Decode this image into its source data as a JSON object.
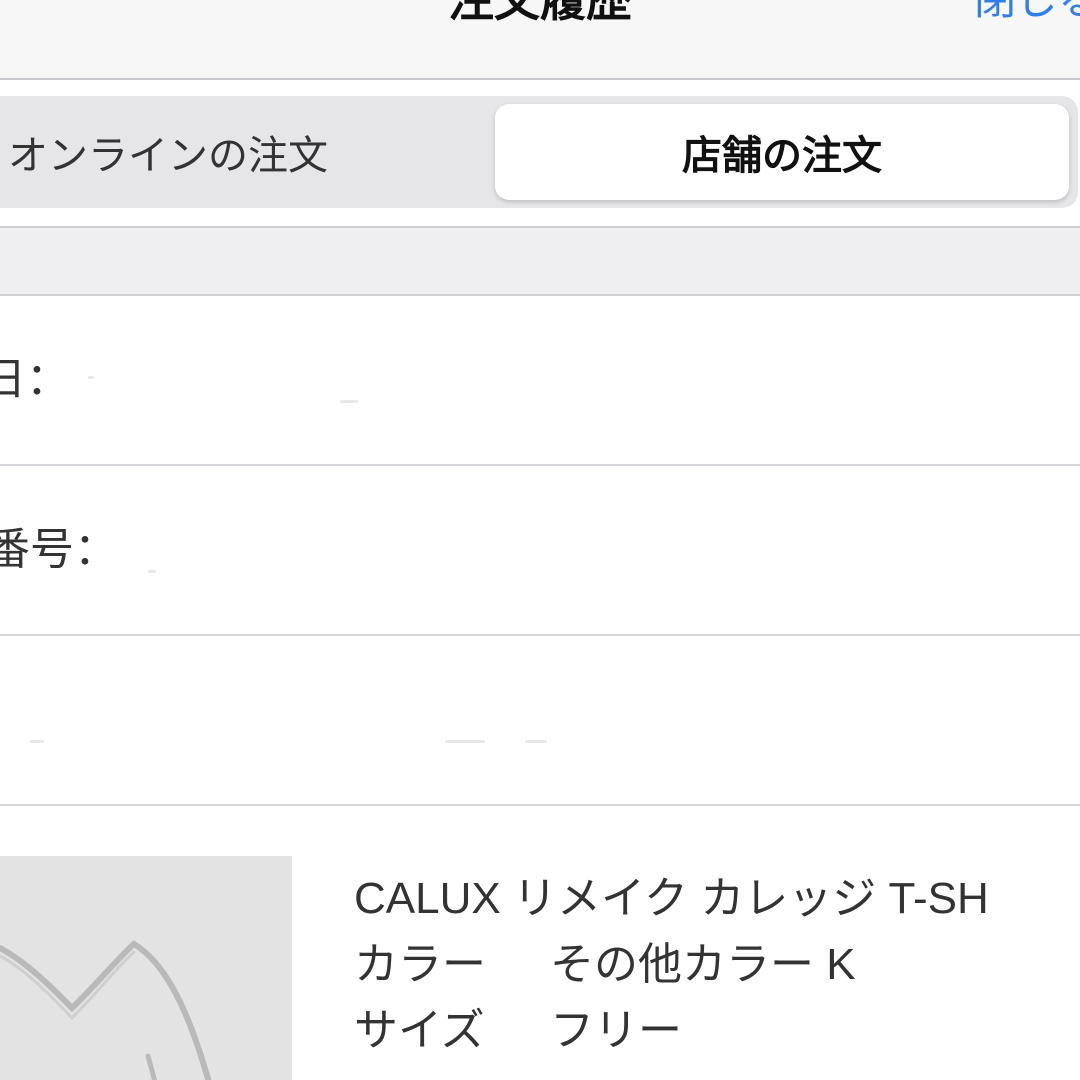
{
  "navbar": {
    "title": "注文履歴",
    "close_label": "閉じる"
  },
  "segments": {
    "online_label": "オンラインの注文",
    "store_label": "店舗の注文",
    "selected": "store"
  },
  "order_info": {
    "date_label": "日：",
    "number_label": "番号："
  },
  "product": {
    "name": "CALUX リメイク カレッジ T-SH",
    "color_label": "カラー",
    "color_value": "その他カラー K",
    "size_label": "サイズ",
    "size_value": "フリー"
  },
  "colors": {
    "accent": "#2f7ef0",
    "segment_track": "#e6e6e9",
    "section_gap": "#efeff2"
  }
}
